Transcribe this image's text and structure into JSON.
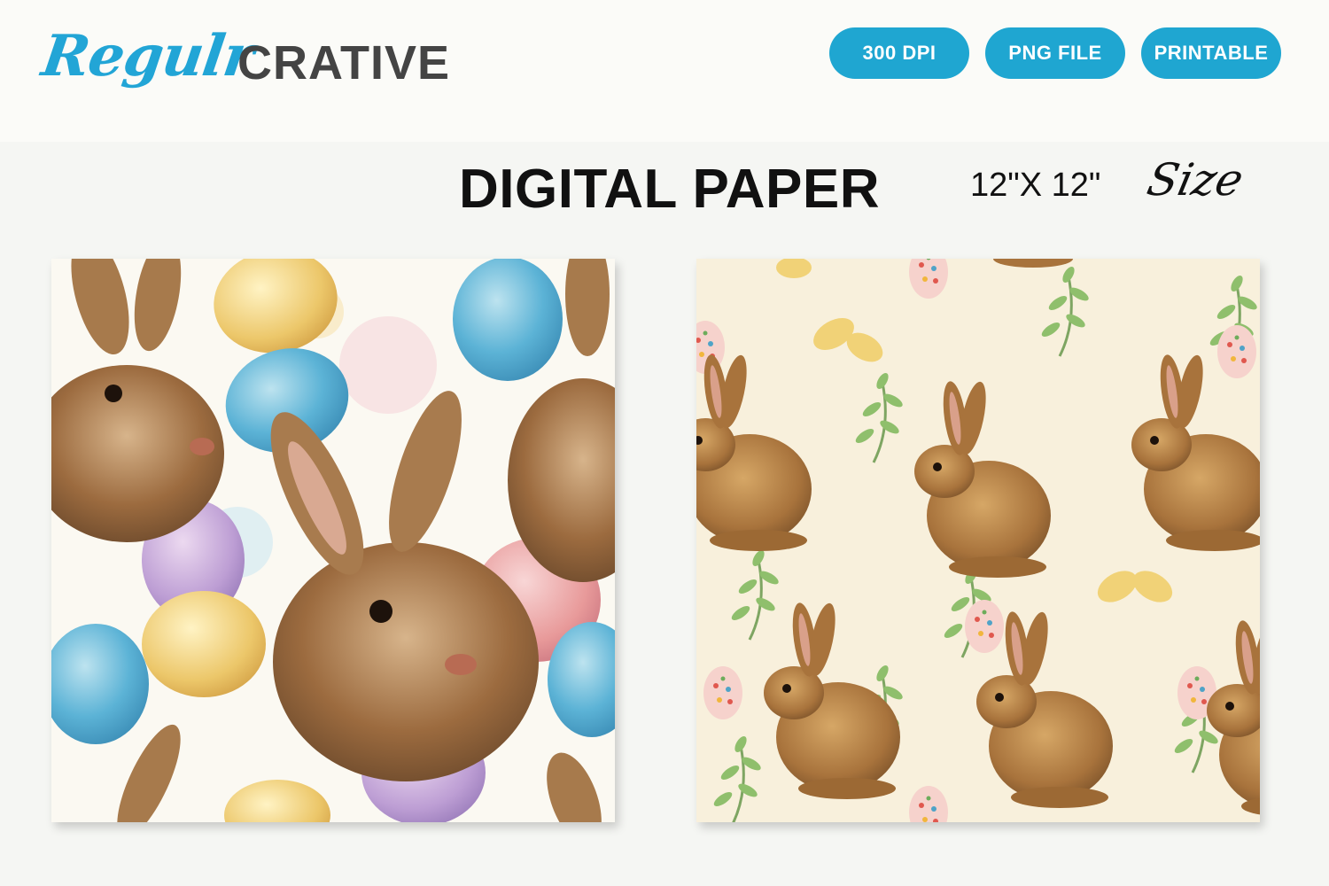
{
  "brand": {
    "script": "Regulr",
    "block": "CRATIVE"
  },
  "badges": [
    "300 DPI",
    "PNG FILE",
    "PRINTABLE"
  ],
  "title": "DIGITAL PAPER",
  "size": {
    "dimensions": "12\"X 12\"",
    "word": "Size"
  },
  "colors": {
    "accent": "#1fa6d1",
    "logo_script": "#22a5d6",
    "logo_block": "#444444"
  }
}
